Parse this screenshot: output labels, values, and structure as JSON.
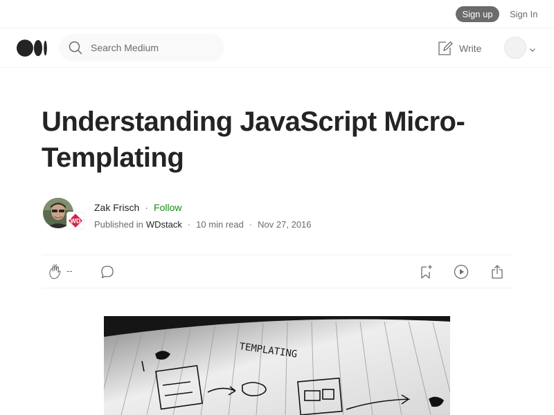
{
  "topbar": {
    "signup_label": "Sign up",
    "signin_label": "Sign In"
  },
  "navbar": {
    "logo_icon": "medium-logo-icon",
    "search": {
      "placeholder": "Search Medium",
      "value": "",
      "icon": "search-icon"
    },
    "write": {
      "label": "Write",
      "icon": "write-icon"
    },
    "avatar_icon": "user-avatar-placeholder",
    "menu_icon": "chevron-down-icon"
  },
  "article": {
    "title": "Understanding JavaScript Micro-Templating",
    "author": {
      "name": "Zak Frisch",
      "follow_label": "Follow"
    },
    "publication": {
      "prefix": "Published in",
      "name": "WDstack",
      "badge_text": "WD",
      "badge_color": "#d3254a"
    },
    "read_time": "10 min read",
    "date": "Nov 27, 2016",
    "separator": "·",
    "actions": {
      "clap_count": "--",
      "clap_icon": "clap-icon",
      "respond_icon": "comment-icon",
      "save_icon": "bookmark-add-icon",
      "listen_icon": "play-icon",
      "share_icon": "share-icon"
    },
    "hero_image": {
      "description_icon": "templating-sketch-image",
      "sketch_text": "TEMPLATING"
    }
  },
  "colors": {
    "accent_green": "#1a8917",
    "primary_text": "#242424",
    "secondary_text": "#6b6b6b",
    "signup_bg": "#6b6b6b"
  }
}
